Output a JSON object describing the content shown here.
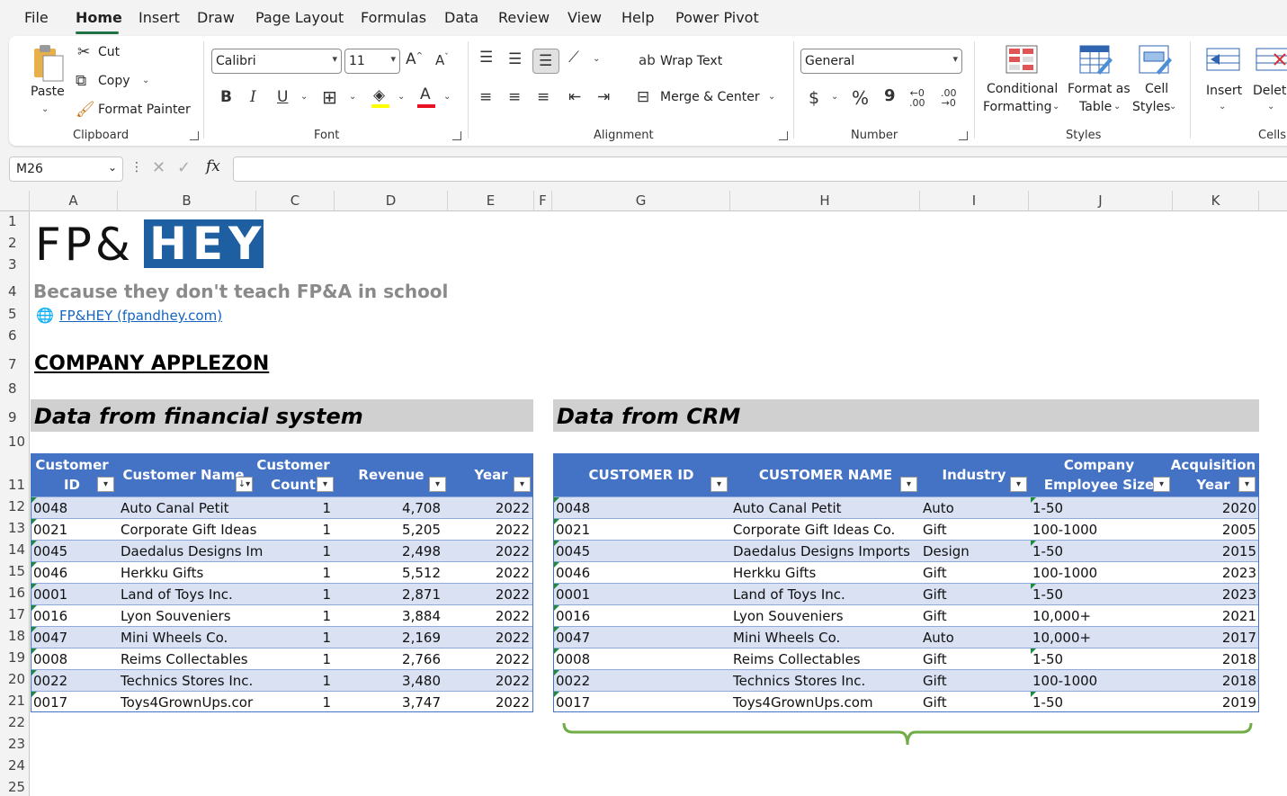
{
  "menu": {
    "tabs": [
      "File",
      "Home",
      "Insert",
      "Draw",
      "Page Layout",
      "Formulas",
      "Data",
      "Review",
      "View",
      "Help",
      "Power Pivot"
    ],
    "active": "Home"
  },
  "ribbon": {
    "clipboard": {
      "paste": "Paste",
      "cut": "Cut",
      "copy": "Copy",
      "format_painter": "Format Painter",
      "group": "Clipboard"
    },
    "font": {
      "family": "Calibri",
      "size": "11",
      "group": "Font",
      "bold": "B",
      "italic": "I",
      "underline": "U",
      "font_color": "#e81123"
    },
    "alignment": {
      "wrap": "Wrap Text",
      "merge": "Merge & Center",
      "group": "Alignment"
    },
    "number": {
      "format": "General",
      "currency": "$",
      "percent": "%",
      "comma": "9",
      "group": "Number"
    },
    "styles": {
      "conditional_1": "Conditional",
      "conditional_2": "Formatting",
      "format_table_1": "Format as",
      "format_table_2": "Table",
      "cell_styles_1": "Cell",
      "cell_styles_2": "Styles",
      "group": "Styles"
    },
    "cells": {
      "insert": "Insert",
      "delete": "Delete",
      "group": "Cells"
    }
  },
  "formula_bar": {
    "name_box": "M26",
    "fx": "fx",
    "content": ""
  },
  "columns": [
    "A",
    "B",
    "C",
    "D",
    "E",
    "F",
    "G",
    "H",
    "I",
    "J",
    "K"
  ],
  "rows": [
    "1",
    "2",
    "3",
    "4",
    "5",
    "6",
    "7",
    "8",
    "9",
    "10",
    "11",
    "12",
    "13",
    "14",
    "15",
    "16",
    "17",
    "18",
    "19",
    "20",
    "21",
    "22",
    "23",
    "24",
    "25"
  ],
  "sheet": {
    "logo_left": "FP&",
    "logo_right": "HEY",
    "tagline": "Because they don't teach FP&A in school",
    "link": "FP&HEY (fpandhey.com)",
    "company": "COMPANY APPLEZON",
    "section_fin": "Data from financial system",
    "section_crm": "Data from CRM"
  },
  "fin_table": {
    "headers": [
      [
        "Customer",
        "ID"
      ],
      [
        "Customer Name"
      ],
      [
        "Customer",
        "Count"
      ],
      [
        "Revenue"
      ],
      [
        "Year"
      ]
    ],
    "rows": [
      [
        "0048",
        "Auto Canal Petit",
        "1",
        "4,708",
        "2022"
      ],
      [
        "0021",
        "Corporate Gift Ideas",
        "1",
        "5,205",
        "2022"
      ],
      [
        "0045",
        "Daedalus Designs Im",
        "1",
        "2,498",
        "2022"
      ],
      [
        "0046",
        "Herkku Gifts",
        "1",
        "5,512",
        "2022"
      ],
      [
        "0001",
        "Land of Toys Inc.",
        "1",
        "2,871",
        "2022"
      ],
      [
        "0016",
        "Lyon Souveniers",
        "1",
        "3,884",
        "2022"
      ],
      [
        "0047",
        "Mini Wheels Co.",
        "1",
        "2,169",
        "2022"
      ],
      [
        "0008",
        "Reims Collectables",
        "1",
        "2,766",
        "2022"
      ],
      [
        "0022",
        "Technics Stores Inc.",
        "1",
        "3,480",
        "2022"
      ],
      [
        "0017",
        "Toys4GrownUps.cor",
        "1",
        "3,747",
        "2022"
      ]
    ]
  },
  "crm_table": {
    "headers": [
      [
        "CUSTOMER ID"
      ],
      [
        "CUSTOMER NAME"
      ],
      [
        "Industry"
      ],
      [
        "Company",
        "Employee Size"
      ],
      [
        "Acquisition",
        "Year"
      ]
    ],
    "rows": [
      [
        "0048",
        "Auto Canal Petit",
        "Auto",
        "1-50",
        "2020"
      ],
      [
        "0021",
        "Corporate Gift Ideas Co.",
        "Gift",
        "100-1000",
        "2005"
      ],
      [
        "0045",
        "Daedalus Designs Imports",
        "Design",
        "1-50",
        "2015"
      ],
      [
        "0046",
        "Herkku Gifts",
        "Gift",
        "100-1000",
        "2023"
      ],
      [
        "0001",
        "Land of Toys Inc.",
        "Gift",
        "1-50",
        "2023"
      ],
      [
        "0016",
        "Lyon Souveniers",
        "Gift",
        "10,000+",
        "2021"
      ],
      [
        "0047",
        "Mini Wheels Co.",
        "Auto",
        "10,000+",
        "2017"
      ],
      [
        "0008",
        "Reims Collectables",
        "Gift",
        "1-50",
        "2018"
      ],
      [
        "0022",
        "Technics Stores Inc.",
        "Gift",
        "100-1000",
        "2018"
      ],
      [
        "0017",
        "Toys4GrownUps.com",
        "Gift",
        "1-50",
        "2019"
      ]
    ]
  },
  "colors": {
    "table_header": "#4472c4",
    "band": "#d9e1f2",
    "brace": "#70ad47",
    "logo_blue": "#1d5fa0"
  }
}
